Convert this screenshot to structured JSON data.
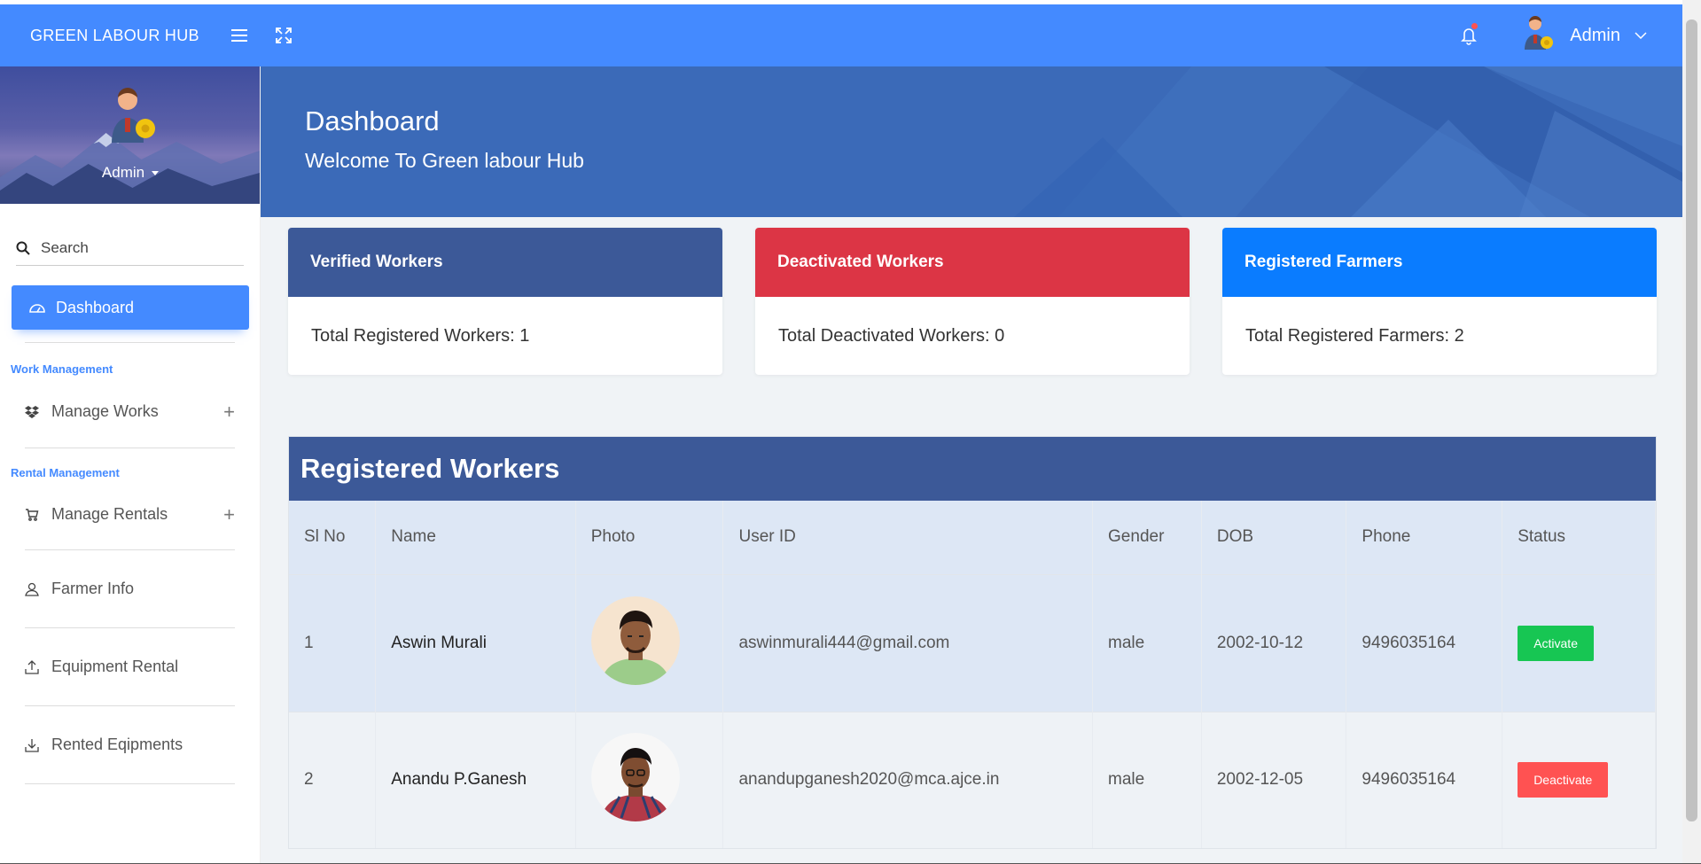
{
  "topbar": {
    "brand": "GREEN LABOUR HUB",
    "menu_icon": "hamburger-menu-icon",
    "fullscreen_icon": "fullscreen-expand-icon",
    "notification_icon": "bell-icon",
    "user_name": "Admin"
  },
  "sidebar": {
    "profile_name": "Admin",
    "search_label": "Search",
    "active_item": "Dashboard",
    "sections": [
      {
        "label": "Work Management"
      },
      {
        "label": "Rental Management"
      }
    ],
    "items": [
      {
        "label": "Manage Works",
        "icon": "dropbox-icon",
        "expandable": "+"
      },
      {
        "label": "Manage Rentals",
        "icon": "cart-icon",
        "expandable": "+"
      },
      {
        "label": "Farmer Info",
        "icon": "user-icon"
      },
      {
        "label": "Equipment Rental",
        "icon": "upload-icon"
      },
      {
        "label": "Rented Eqipments",
        "icon": "download-icon"
      }
    ]
  },
  "hero": {
    "title": "Dashboard",
    "subtitle": "Welcome To Green labour Hub"
  },
  "cards": [
    {
      "title": "Verified Workers",
      "body": "Total Registered Workers: 1",
      "color": "#3c5998"
    },
    {
      "title": "Deactivated Workers",
      "body": "Total Deactivated Workers: 0",
      "color": "#dc3545"
    },
    {
      "title": "Registered Farmers",
      "body": "Total Registered Farmers: 2",
      "color": "#0a7cff"
    }
  ],
  "workers_table": {
    "title": "Registered Workers",
    "columns": [
      "Sl No",
      "Name",
      "Photo",
      "User ID",
      "Gender",
      "DOB",
      "Phone",
      "Status"
    ],
    "rows": [
      {
        "sl": "1",
        "name": "Aswin Murali",
        "user_id": "aswinmurali444@gmail.com",
        "gender": "male",
        "dob": "2002-10-12",
        "phone": "9496035164",
        "status": "Activate"
      },
      {
        "sl": "2",
        "name": "Anandu P.Ganesh",
        "user_id": "anandupganesh2020@mca.ajce.in",
        "gender": "male",
        "dob": "2002-12-05",
        "phone": "9496035164",
        "status": "Deactivate"
      }
    ]
  }
}
